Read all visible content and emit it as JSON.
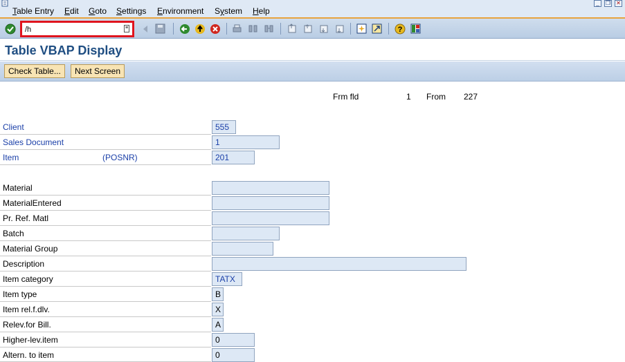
{
  "menu": {
    "items": [
      "Table Entry",
      "Edit",
      "Goto",
      "Settings",
      "Environment",
      "System",
      "Help"
    ],
    "underline": [
      "T",
      "E",
      "G",
      "S",
      "E",
      "y",
      "H"
    ]
  },
  "toolbar": {
    "command_value": "/h",
    "command_dropdown": "≡"
  },
  "title": "Table VBAP Display",
  "app_toolbar": {
    "check_table": "Check Table...",
    "next_screen": "Next Screen"
  },
  "header": {
    "frm_fld_label": "Frm fld",
    "frm_fld_value": "1",
    "from_label": "From",
    "from_value": "227"
  },
  "fields": [
    {
      "label": "Client",
      "tech": "",
      "value": "555",
      "key": true
    },
    {
      "label": "Sales Document",
      "tech": "",
      "value": "1",
      "key": true
    },
    {
      "label": "Item",
      "tech": "(POSNR)",
      "value": "201",
      "key": true
    },
    {
      "label": "Material",
      "tech": "",
      "value": "",
      "key": false
    },
    {
      "label": "MaterialEntered",
      "tech": "",
      "value": "",
      "key": false
    },
    {
      "label": "Pr. Ref. Matl",
      "tech": "",
      "value": "",
      "key": false
    },
    {
      "label": "Batch",
      "tech": "",
      "value": "",
      "key": false
    },
    {
      "label": "Material Group",
      "tech": "",
      "value": "",
      "key": false
    },
    {
      "label": "Description",
      "tech": "",
      "value": "",
      "key": false
    },
    {
      "label": "Item category",
      "tech": "",
      "value": "TATX",
      "key": false
    },
    {
      "label": "Item type",
      "tech": "",
      "value": "B",
      "key": false
    },
    {
      "label": "Item rel.f.dlv.",
      "tech": "",
      "value": "X",
      "key": false
    },
    {
      "label": "Relev.for Bill.",
      "tech": "",
      "value": "A",
      "key": false
    },
    {
      "label": "Higher-lev.item",
      "tech": "",
      "value": "0",
      "key": false
    },
    {
      "label": "Altern. to item",
      "tech": "",
      "value": "0",
      "key": false
    }
  ],
  "colors": {
    "title": "#1f4e82",
    "key_text": "#1a3fa8",
    "field_bg": "#dde8f5",
    "highlight": "#e0141e"
  }
}
